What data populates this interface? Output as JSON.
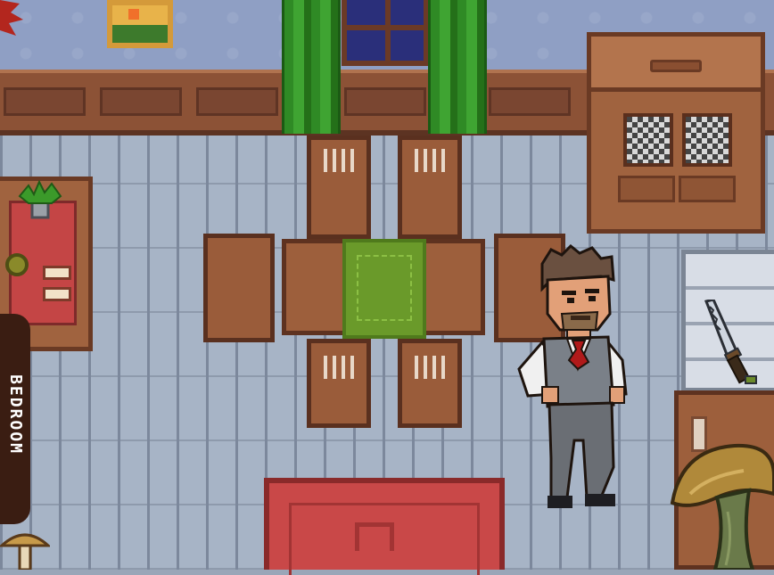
{
  "scene": {
    "location_tab": {
      "label": "BEDROOM"
    },
    "colors": {
      "floor": "#a7b4c6",
      "wall": "#8f9fc4",
      "wood": "#9d5f3c",
      "curtain": "#3fa432",
      "rug": "#c94848",
      "tab": "#3a1d12"
    },
    "objects": [
      "painting",
      "window",
      "curtains",
      "cabinet",
      "dining-table",
      "chairs",
      "shelf",
      "plant",
      "fridge",
      "knife",
      "dresser",
      "mushroom",
      "rug",
      "character"
    ]
  }
}
